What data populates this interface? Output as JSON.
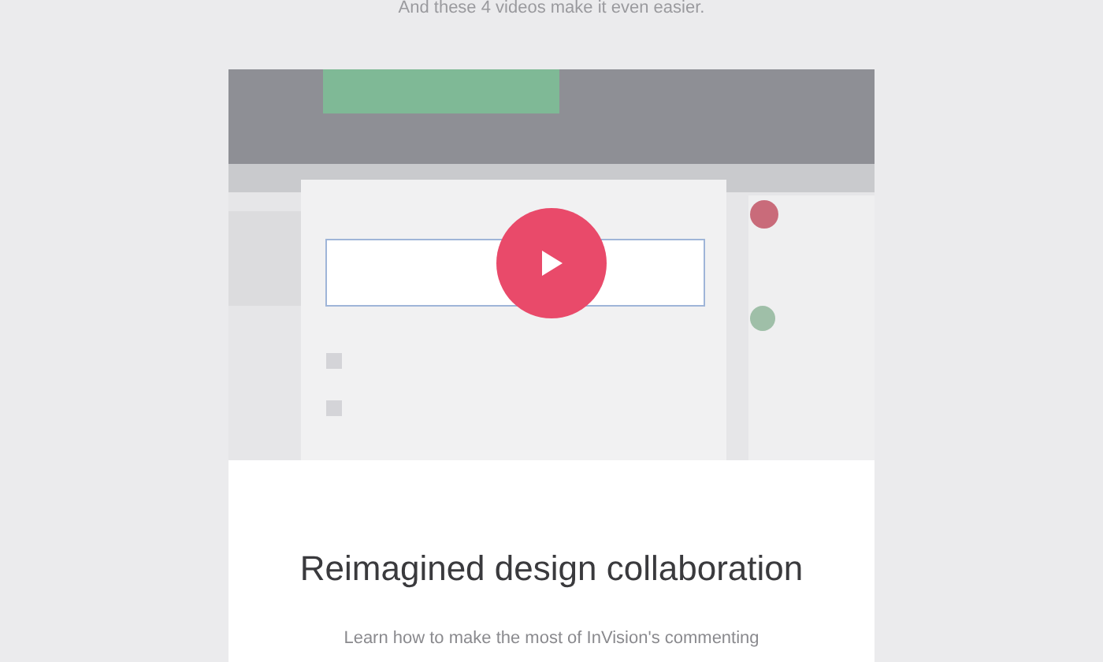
{
  "intro": "And these 4 videos make it even easier.",
  "heading": "Reimagined design collaboration",
  "description": "Learn how to make the most of InVision's commenting"
}
